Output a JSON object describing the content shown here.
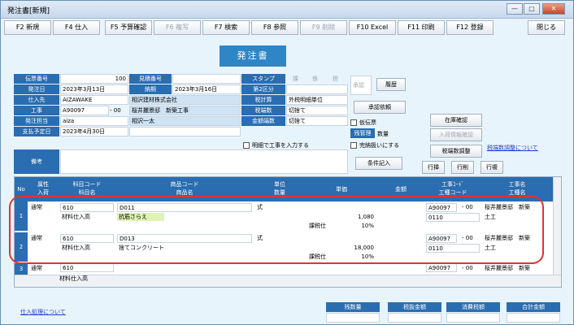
{
  "window": {
    "title": "発注書[新規]",
    "minimize": "—",
    "maximize": "□",
    "close": "✕"
  },
  "fkeys": [
    {
      "label": "F2 新規",
      "enabled": true
    },
    {
      "label": "F4 仕入",
      "enabled": true
    },
    {
      "label": "F5 予算確認",
      "enabled": true
    },
    {
      "label": "F6 複写",
      "enabled": false
    },
    {
      "label": "F7 検索",
      "enabled": true
    },
    {
      "label": "F8 参照",
      "enabled": true
    },
    {
      "label": "F9 削除",
      "enabled": false
    },
    {
      "label": "F10 Excel",
      "enabled": true
    },
    {
      "label": "F11 印刷",
      "enabled": true
    },
    {
      "label": "F12 登録",
      "enabled": true
    }
  ],
  "close_button": "閉じる",
  "form_title": "発注書",
  "header": {
    "denpyo_no_label": "伝票番号",
    "denpyo_no": "100",
    "mitsumori_label": "見積番号",
    "mitsumori": "",
    "stamp_label": "スタンプ",
    "stamp_cols": [
      "課",
      "係",
      "担"
    ],
    "shounin": "承認",
    "rireki": "履歴",
    "hacchubi_label": "発注日",
    "hacchubi": "2023年3月13日",
    "nouki_label": "納期",
    "nouki": "2023年3月16日",
    "kubun2_label": "第2区分",
    "kubun2": "",
    "shiiresaki_label": "仕入先",
    "shiiresaki_code": "AIZAWAKE",
    "shiiresaki_name": "相沢建材株式会社",
    "zeikeisan_label": "税計算",
    "zeikeisan": "外税明細単位",
    "shounin_irai": "承認依頼",
    "kouji_label": "工事",
    "kouji_code": "A90097",
    "kouji_sub": "- 00",
    "kouji_name": "桜井麗景邸　新築工事",
    "zeihasu_label": "税端数",
    "zeihasu": "切捨て",
    "zaiko": "在庫確認",
    "tantou_label": "発注担当",
    "tantou_code": "aiza",
    "tantou_name": "相沢一太",
    "kingakuhasu_label": "金額端数",
    "kingakuhasu": "切捨て",
    "kari_denpyo": "仮伝票",
    "nyuka_kakunin": "入荷情報確認",
    "shiharai_label": "支払予定日",
    "shiharai": "2023年4月30日",
    "zan_kanri_label": "残管理",
    "zan_kanri": "数量",
    "meisai_kouji": "明細で工事を入力する",
    "kanno": "完納扱いにする",
    "zeihasu_chousei": "税端数調整",
    "zeihasu_link": "税端数調整について",
    "bikou_label": "備考",
    "bikou": "",
    "jouken": "条件記入",
    "gyou_ins": "行挿",
    "gyou_del": "行削",
    "gyou_copy": "行複"
  },
  "grid": {
    "headers": {
      "no": "No",
      "zokusei": "属性",
      "nyushutsuko": "入荷",
      "kamoku_code": "科目コード",
      "kamoku_name": "科目名",
      "shohin_code": "商品コード",
      "shohin_name": "商品名",
      "tani": "単位",
      "suryo": "数量",
      "tanka": "単価",
      "kingaku": "金額",
      "kouji_code": "工事ｺｰﾄﾞ",
      "kouji_sub": "工種コード",
      "kouji_name": "工事名",
      "koushu_name": "工種名"
    },
    "rows": [
      {
        "no": "1",
        "zokusei": "通常",
        "kamoku_code": "610",
        "kamoku_name": "材料仕入高",
        "shohin_code": "D011",
        "shohin_name": "抗筋さらえ",
        "tani": "式",
        "kingaku": "1,080",
        "zei": "課税仕",
        "zeiritsu": "10%",
        "kouji_code": "A90097",
        "kouji_sub": "- 00",
        "kouji_name": "桜井麗景邸　新築",
        "koushu_code": "0110",
        "koushu_name": "土工"
      },
      {
        "no": "2",
        "zokusei": "通常",
        "kamoku_code": "610",
        "kamoku_name": "材料仕入高",
        "shohin_code": "D013",
        "shohin_name": "捨てコンクリート",
        "tani": "式",
        "kingaku": "18,000",
        "zei": "課税仕",
        "zeiritsu": "10%",
        "kouji_code": "A90097",
        "kouji_sub": "- 00",
        "kouji_name": "桜井麗景邸　新築",
        "koushu_code": "0110",
        "koushu_name": "土工"
      },
      {
        "no": "3",
        "zokusei": "通常",
        "kamoku_code": "610",
        "kamoku_name": "材料仕入高",
        "shohin_code": "",
        "shohin_name": "",
        "tani": "",
        "kingaku": "",
        "zei": "",
        "zeiritsu": "",
        "kouji_code": "A90097",
        "kouji_sub": "- 00",
        "kouji_name": "桜井麗景邸　新築",
        "koushu_code": "",
        "koushu_name": ""
      }
    ]
  },
  "summary": {
    "zan_suryo": "残数量",
    "zeinuki": "税抜金額",
    "shouhizei": "消費税額",
    "goukei": "合計金額"
  },
  "footer_link": "仕入処理について"
}
